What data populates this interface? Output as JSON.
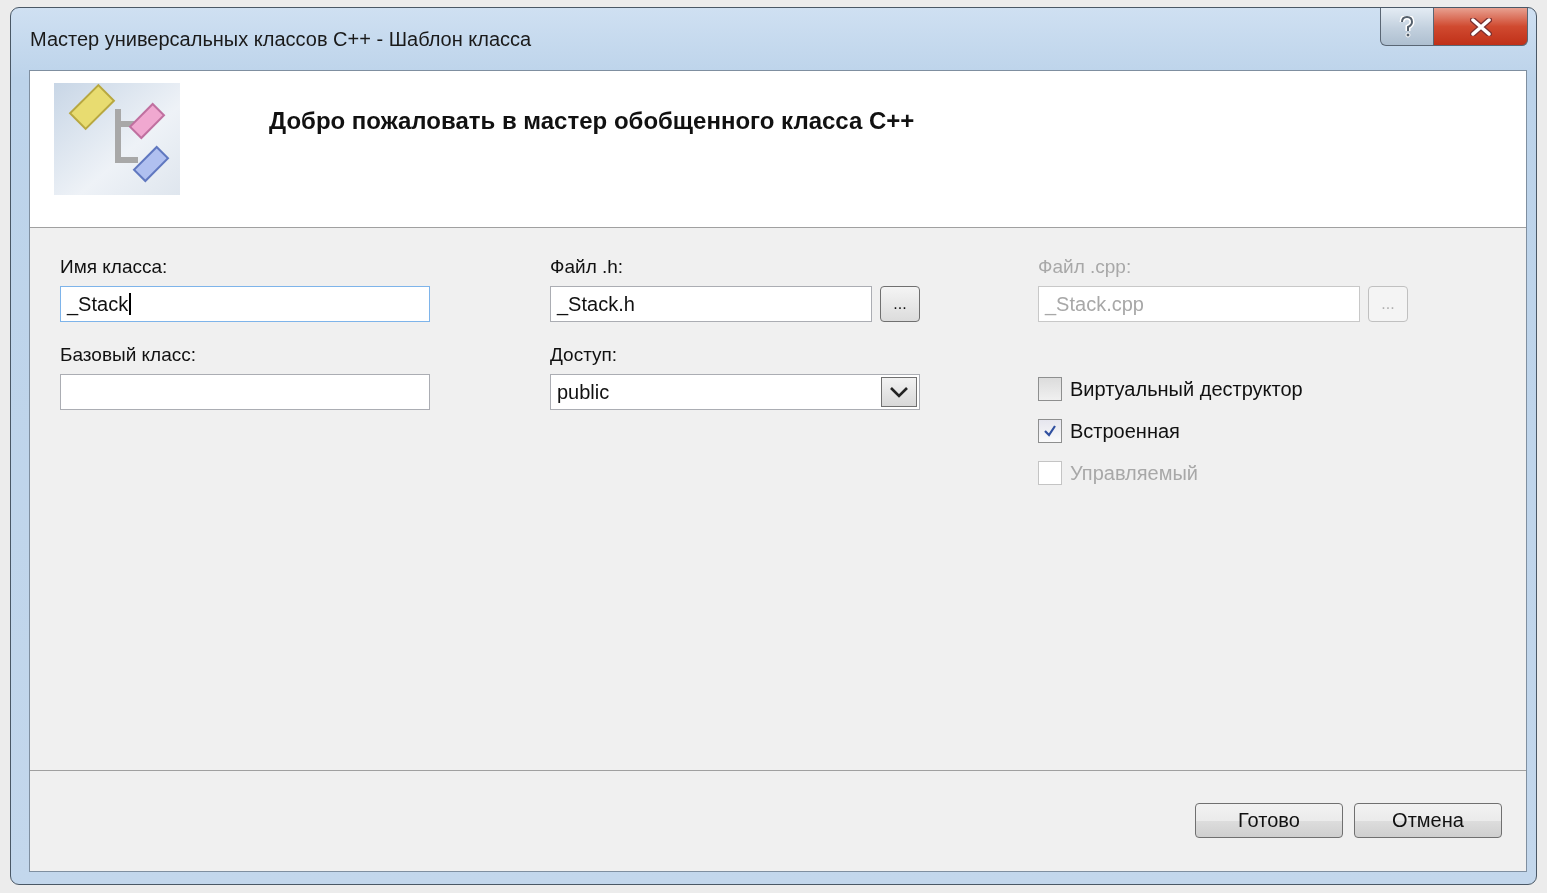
{
  "window": {
    "title": "Мастер универсальных классов C++ - Шаблон класса"
  },
  "header": {
    "title": "Добро пожаловать в мастер обобщенного класса C++"
  },
  "columns": [
    [
      {
        "kind": "text",
        "label": "Имя класса:",
        "value": "_Stack",
        "focused": true
      },
      {
        "kind": "text",
        "label": "Базовый класс:",
        "focused": false
      }
    ],
    [
      {
        "kind": "file",
        "label": "Файл .h:",
        "value": "_Stack.h",
        "browse_label": "...",
        "disabled": false
      },
      {
        "kind": "combo",
        "label": "Доступ:",
        "value": "public"
      }
    ],
    [
      {
        "kind": "file",
        "label": "Файл .cpp:",
        "value": "_Stack.cpp",
        "browse_label": "...",
        "disabled": true
      },
      {
        "kind": "checkbox",
        "label": "Виртуальный деструктор",
        "checked": false,
        "disabled": false
      },
      {
        "kind": "checkbox",
        "label": "Встроенная",
        "checked": true,
        "disabled": false
      },
      {
        "kind": "checkbox",
        "label": "Управляемый",
        "checked": false,
        "disabled": true
      }
    ]
  ],
  "buttons": [
    {
      "label": "Готово"
    },
    {
      "label": "Отмена"
    }
  ]
}
